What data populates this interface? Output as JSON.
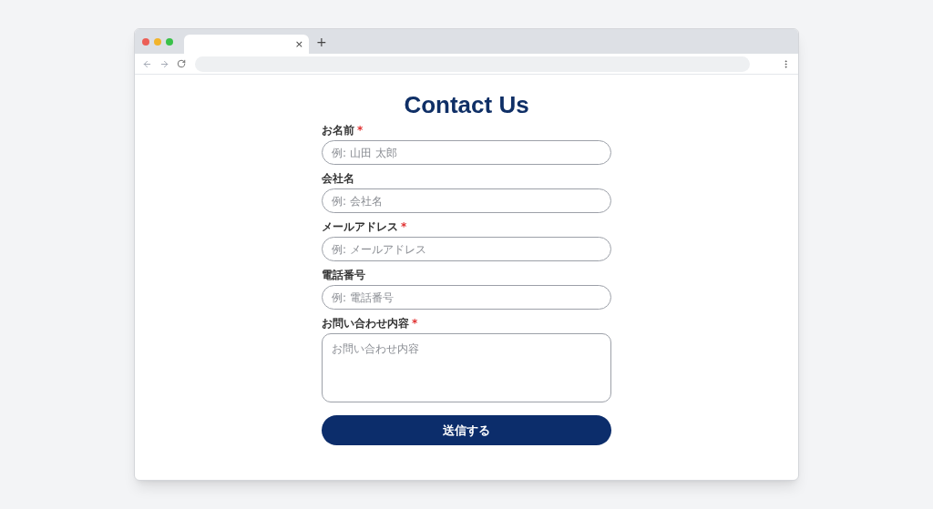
{
  "browser": {
    "new_tab": "+",
    "tab_close": "×"
  },
  "page": {
    "title": "Contact Us",
    "fields": [
      {
        "kind": "input",
        "label": "お名前",
        "required_mark": "*",
        "placeholder": "例: 山田 太郎"
      },
      {
        "kind": "input",
        "label": "会社名",
        "placeholder": "例: 会社名"
      },
      {
        "kind": "input",
        "label": "メールアドレス",
        "required_mark": "*",
        "placeholder": "例: メールアドレス"
      },
      {
        "kind": "input",
        "label": "電話番号",
        "placeholder": "例: 電話番号"
      },
      {
        "kind": "textarea",
        "label": "お問い合わせ内容",
        "required_mark": "*",
        "placeholder": "お問い合わせ内容"
      }
    ],
    "submit": "送信する"
  }
}
